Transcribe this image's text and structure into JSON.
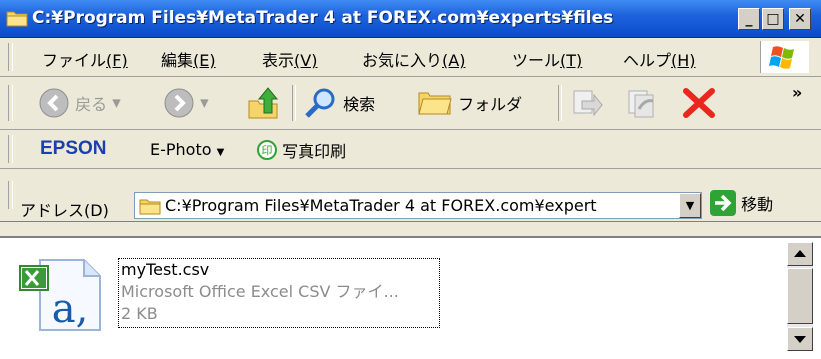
{
  "window": {
    "title": "C:¥Program Files¥MetaTrader 4 at FOREX.com¥experts¥files",
    "min_label": "_",
    "max_label": "□",
    "close_label": "✕"
  },
  "menu": {
    "items": [
      {
        "label": "ファイル",
        "accel": "(F)"
      },
      {
        "label": "編集",
        "accel": "(E)"
      },
      {
        "label": "表示",
        "accel": "(V)"
      },
      {
        "label": "お気に入り",
        "accel": "(A)"
      },
      {
        "label": "ツール",
        "accel": "(T)"
      },
      {
        "label": "ヘルプ",
        "accel": "(H)"
      }
    ]
  },
  "toolbar": {
    "back_label": "戻る",
    "search_label": "検索",
    "folders_label": "フォルダ",
    "more_label": "»"
  },
  "epson": {
    "brand": "EPSON",
    "ephoto_label": "E-Photo",
    "print_label": "写真印刷"
  },
  "address": {
    "label": "アドレス(D)",
    "value": "C:¥Program Files¥MetaTrader 4 at FOREX.com¥expert",
    "go_label": "移動"
  },
  "files": [
    {
      "name": "myTest.csv",
      "type": "Microsoft Office Excel CSV ファイ...",
      "size": "2 KB"
    }
  ],
  "colors": {
    "title_bar": "#1E63DC",
    "close_x": "#E8281E",
    "go_green": "#2FA336"
  }
}
